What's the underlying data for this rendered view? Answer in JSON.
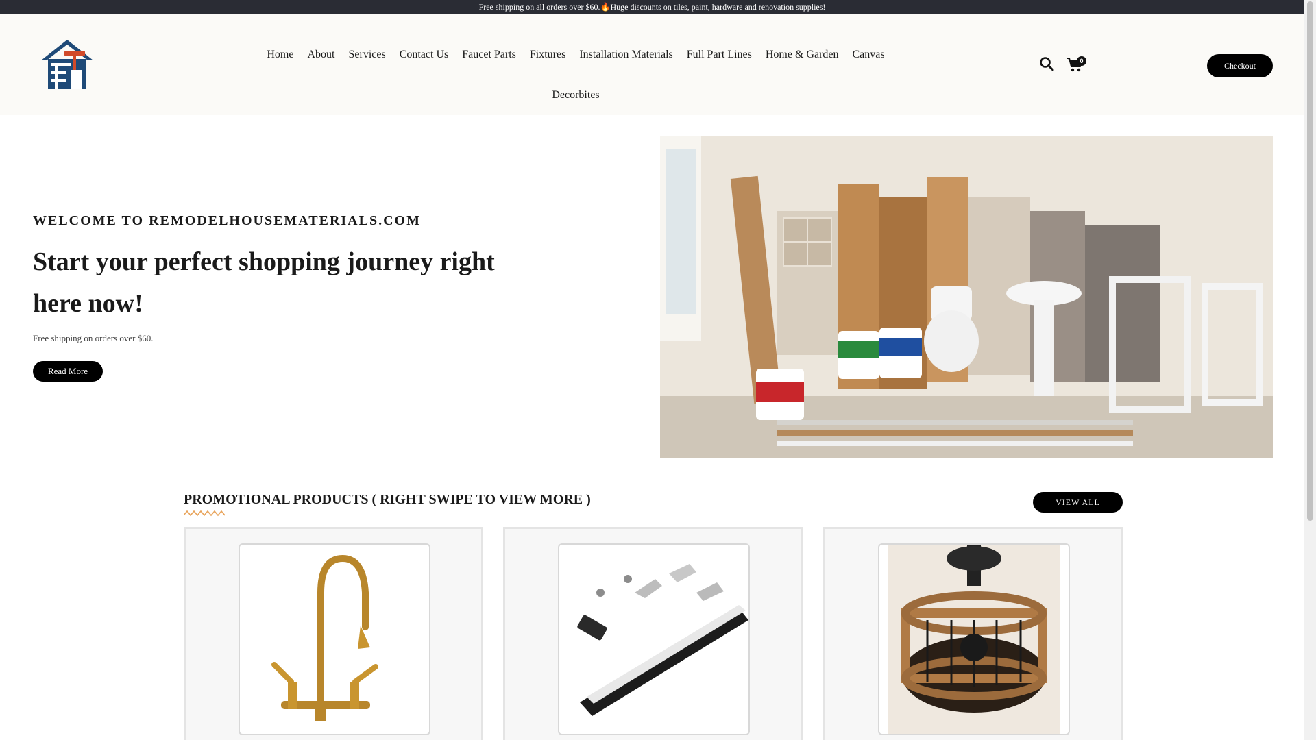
{
  "announcement": {
    "text_before": "Free shipping on all orders over $60.",
    "icon": "fire-icon",
    "text_after": "Huge discounts on tiles, paint, hardware and renovation supplies!"
  },
  "header": {
    "logo": "house-tools-logo",
    "nav": [
      "Home",
      "About",
      "Services",
      "Contact Us",
      "Faucet Parts",
      "Fixtures",
      "Installation Materials",
      "Full Part Lines",
      "Home & Garden",
      "Canvas",
      "Decorbites"
    ],
    "cart_count": "0",
    "checkout_label": "Checkout"
  },
  "hero": {
    "eyebrow": "WELCOME TO REMODELHOUSEMATERIALS.COM",
    "title": "Start your perfect shopping journey right here now!",
    "subtitle": "Free shipping on orders over $60.",
    "cta_label": "Read More"
  },
  "promo": {
    "title": "PROMOTIONAL PRODUCTS ( RIGHT SWIPE TO VIEW MORE )",
    "view_all_label": "VIEW ALL",
    "products": [
      {
        "image": "gold-bridge-kitchen-faucet"
      },
      {
        "image": "led-aluminum-channel-kit"
      },
      {
        "image": "caged-ceiling-fan-light"
      }
    ]
  },
  "colors": {
    "topbar": "#2a2c34",
    "header_bg": "#fbfaf7",
    "button": "#000000",
    "accent_underline": "#e8a35a",
    "logo_blue": "#1f4a78"
  }
}
